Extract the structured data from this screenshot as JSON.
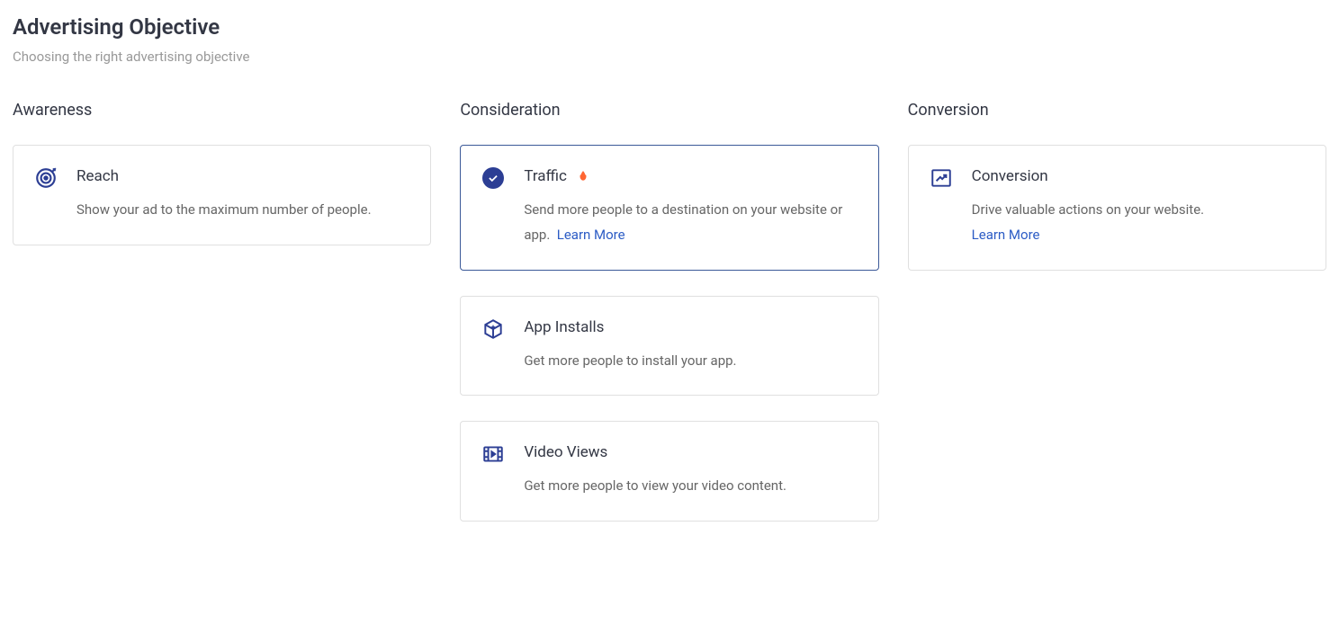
{
  "header": {
    "title": "Advertising Objective",
    "subtitle": "Choosing the right advertising objective"
  },
  "columns": {
    "awareness": {
      "label": "Awareness",
      "cards": {
        "reach": {
          "title": "Reach",
          "desc": "Show your ad to the maximum number of people."
        }
      }
    },
    "consideration": {
      "label": "Consideration",
      "cards": {
        "traffic": {
          "title": "Traffic",
          "desc": "Send more people to a destination on your website or app.",
          "learn_more": "Learn More"
        },
        "app_installs": {
          "title": "App Installs",
          "desc": "Get more people to install your app."
        },
        "video_views": {
          "title": "Video Views",
          "desc": "Get more people to view your video content."
        }
      }
    },
    "conversion": {
      "label": "Conversion",
      "cards": {
        "conversion": {
          "title": "Conversion",
          "desc": "Drive valuable actions on your website.",
          "learn_more": "Learn More"
        }
      }
    }
  }
}
